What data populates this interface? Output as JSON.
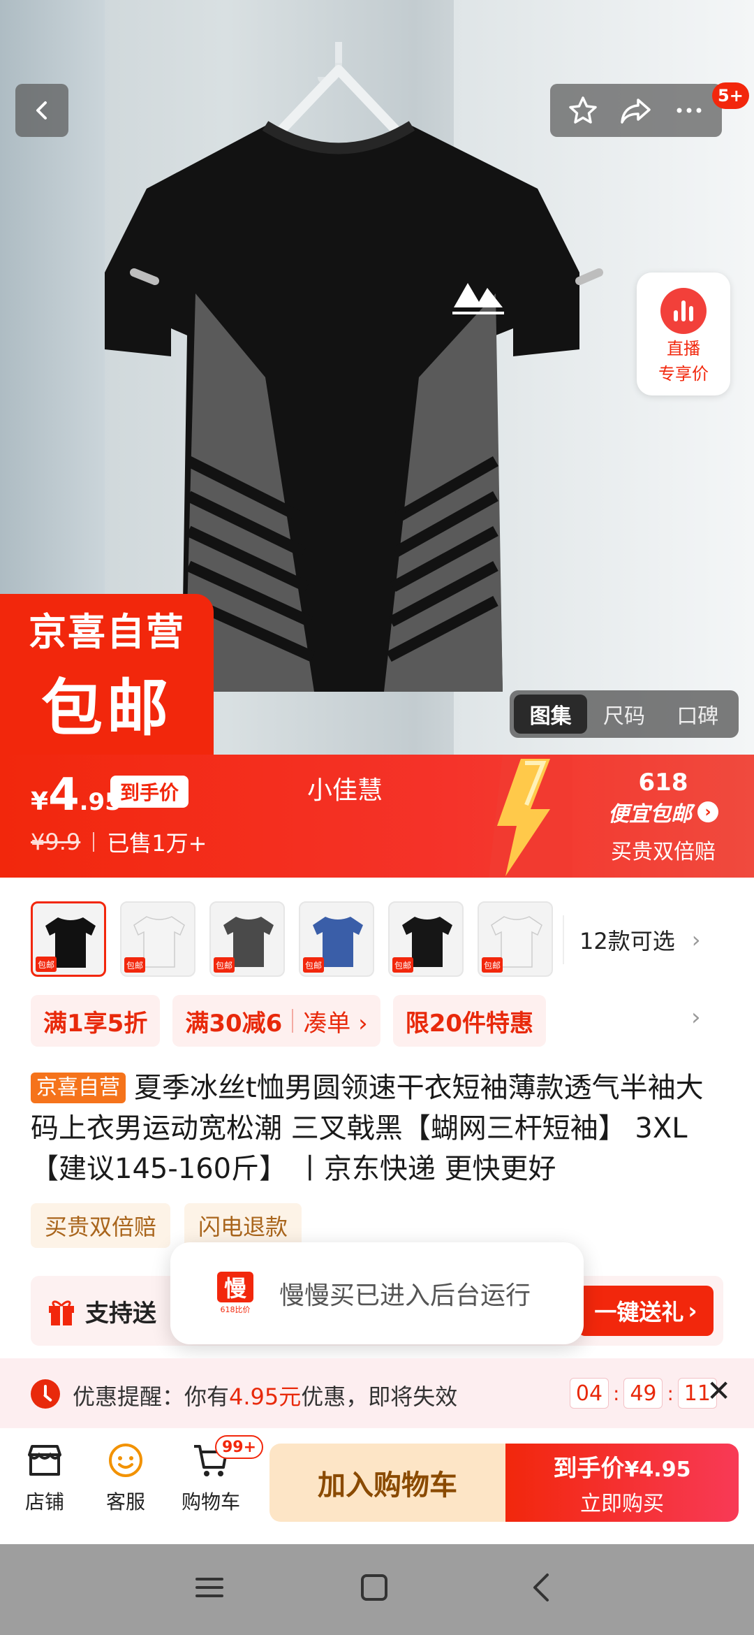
{
  "media": {
    "tabs": [
      {
        "label": "图集",
        "active": true
      },
      {
        "label": "尺码",
        "active": false
      },
      {
        "label": "口碑",
        "active": false
      }
    ],
    "share_badge": "5+",
    "live_card": {
      "line1": "直播",
      "line2": "专享价"
    },
    "jx_badge": {
      "line1": "京喜自营",
      "line2": "包邮"
    }
  },
  "price_banner": {
    "currency": "¥",
    "price_int": "4",
    "price_dec": ".95",
    "price_tag": "到手价",
    "original_price": "¥9.9",
    "sold": "已售1万+",
    "live_name": "小佳慧",
    "promo_618": "618",
    "promo_slogan": "便宜包邮",
    "promo_guarantee": "买贵双倍赔"
  },
  "variants": {
    "more_label": "12款可选",
    "tag_label": "包邮",
    "colors": [
      "#111111",
      "#f4f4f4",
      "#4a4a4a",
      "#3a5ea8",
      "#161616",
      "#f5f5f5"
    ]
  },
  "promos": [
    {
      "text": "满1享5折"
    },
    {
      "text": "满30减6",
      "link": "凑单 ›"
    },
    {
      "text": "限20件特惠"
    }
  ],
  "title": {
    "tag": "京喜自营",
    "text": "夏季冰丝t恤男圆领速干衣短袖薄款透气半袖大码上衣男运动宽松潮 三叉戟黑【蝴网三杆短袖】 3XL 【建议145-160斤】 丨京东快递 更快更好"
  },
  "services": [
    "买贵双倍赔",
    "闪电退款"
  ],
  "gift": {
    "label": "支持送",
    "button": "一键送礼"
  },
  "toast": {
    "app_glyph": "慢",
    "app_sub": "618比价",
    "message": "慢慢买已进入后台运行"
  },
  "reminder": {
    "prefix": "优惠提醒：你有",
    "amount": "4.95元",
    "suffix": "优惠，即将失效",
    "h": "04",
    "m": "49",
    "s": "11"
  },
  "bottom_bar": {
    "shop": "店铺",
    "service": "客服",
    "cart": "购物车",
    "cart_badge": "99+",
    "add_to_cart": "加入购物车",
    "buy_line1": "到手价",
    "buy_price": "¥4.95",
    "buy_line2": "立即购买"
  },
  "colors": {
    "brand_red": "#f2270c",
    "service_gold": "#a9651c"
  }
}
